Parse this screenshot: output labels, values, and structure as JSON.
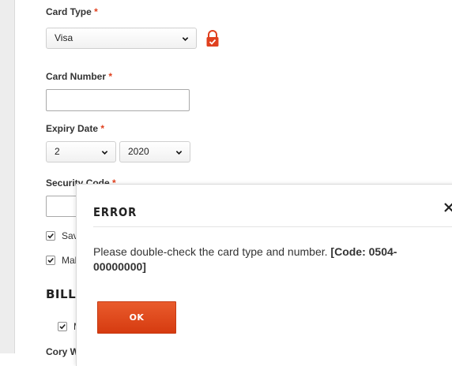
{
  "card_type": {
    "label": "Card Type",
    "required_mark": "*",
    "value": "Visa"
  },
  "card_number": {
    "label": "Card Number",
    "required_mark": "*",
    "value": ""
  },
  "expiry": {
    "label": "Expiry Date",
    "required_mark": "*",
    "month": "2",
    "year": "2020"
  },
  "security_code": {
    "label": "Security Code",
    "required_mark": "*"
  },
  "checkboxes": [
    {
      "label": "Sav",
      "checked": true
    },
    {
      "label": "Mak",
      "checked": true
    }
  ],
  "billing": {
    "heading": "BILLIN",
    "checkbox_label": "M",
    "checked": true,
    "next_label": "Cory W"
  },
  "modal": {
    "title": "ERROR",
    "message": "Please double-check the card type and number. ",
    "code": "[Code: 0504-00000000]",
    "ok_label": "OK"
  },
  "colors": {
    "accent": "#e0401e",
    "button": "#d9421a"
  }
}
